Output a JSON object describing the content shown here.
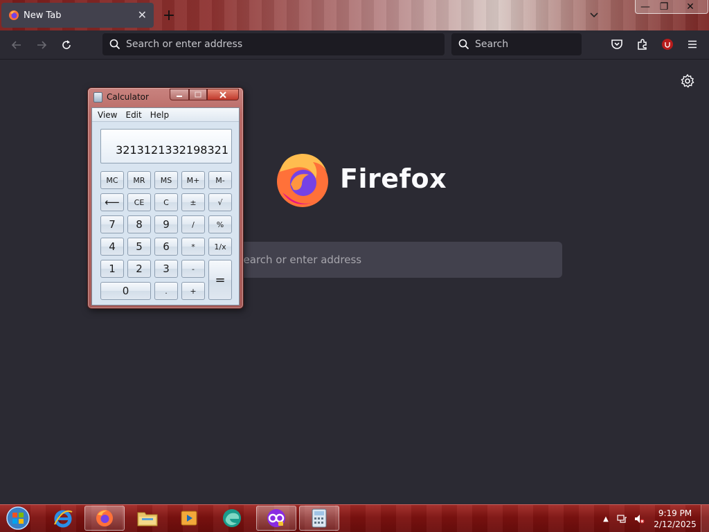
{
  "browser": {
    "tab": {
      "title": "New Tab",
      "close_glyph": "✕"
    },
    "new_tab_glyph": "+",
    "window_controls": {
      "minimize": "—",
      "maximize": "❐",
      "close": "✕"
    },
    "url_placeholder": "Search or enter address",
    "search_placeholder": "Search",
    "brand_name": "Firefox",
    "content_search_placeholder": "Search or enter address",
    "colors": {
      "toolbar": "#2b2a33",
      "field": "#1c1b22",
      "content_field": "#42414d",
      "ublock_red": "#b71c1c"
    }
  },
  "calculator": {
    "title": "Calculator",
    "menu": [
      "View",
      "Edit",
      "Help"
    ],
    "display_value": "3213121332198321",
    "buttons": {
      "mc": "MC",
      "mr": "MR",
      "ms": "MS",
      "mplus": "M+",
      "mminus": "M-",
      "backspace": "⟵",
      "ce": "CE",
      "c": "C",
      "plusminus": "±",
      "sqrt": "√",
      "seven": "7",
      "eight": "8",
      "nine": "9",
      "divide": "/",
      "percent": "%",
      "four": "4",
      "five": "5",
      "six": "6",
      "multiply": "*",
      "reciprocal": "1/x",
      "one": "1",
      "two": "2",
      "three": "3",
      "minus": "-",
      "equals": "=",
      "zero": "0",
      "decimal": ".",
      "plus": "+"
    }
  },
  "taskbar": {
    "time": "9:19 PM",
    "date": "2/12/2025",
    "tray_arrow": "▲",
    "apps": [
      "internet-explorer",
      "firefox",
      "file-explorer",
      "media-player",
      "edge-legacy",
      "pcsx-like-app",
      "calculator"
    ]
  }
}
